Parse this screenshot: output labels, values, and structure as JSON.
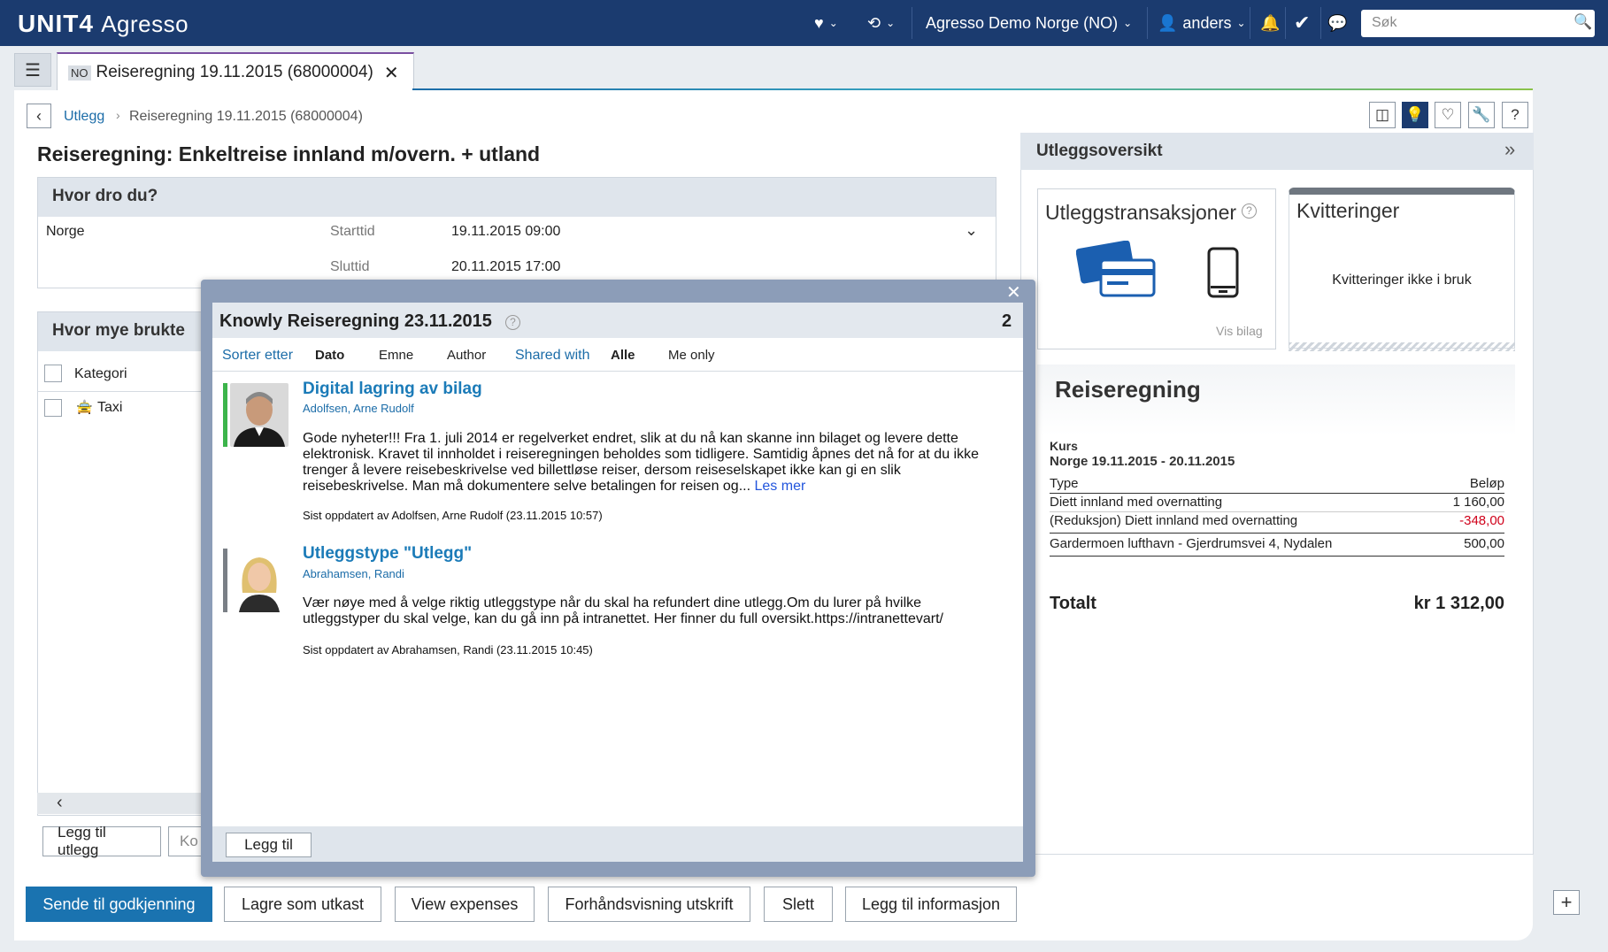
{
  "topbar": {
    "logo_brand": "UNIT4",
    "logo_product": "Agresso",
    "favorites_icon": "heart-icon",
    "history_icon": "history-icon",
    "company": "Agresso Demo Norge (NO)",
    "user": "anders",
    "search_placeholder": "Søk"
  },
  "tabs": [
    {
      "lang": "NO",
      "label": "Reiseregning 19.11.2015 (68000004)"
    }
  ],
  "breadcrumb": {
    "parent": "Utlegg",
    "current": "Reiseregning 19.11.2015 (68000004)"
  },
  "page": {
    "title": "Reiseregning: Enkeltreise innland m/overn. + utland"
  },
  "where": {
    "heading": "Hvor dro du?",
    "destination": "Norge",
    "start_label": "Starttid",
    "start_value": "19.11.2015 09:00",
    "end_label": "Sluttid",
    "end_value": "20.11.2015 17:00"
  },
  "howmuch": {
    "heading": "Hvor mye brukte",
    "col_category": "Kategori",
    "rows": [
      {
        "category": "Taxi"
      }
    ],
    "add_expense": "Legg til utlegg",
    "copy_btn": "Ko"
  },
  "right_panel": {
    "heading": "Utleggsoversikt",
    "transactions_title": "Utleggstransaksjoner",
    "view_attachment": "Vis bilag",
    "receipts_title": "Kvitteringer",
    "receipts_status": "Kvitteringer ikke i bruk",
    "summary": {
      "title": "Reiseregning",
      "kurs_label": "Kurs",
      "kurs_value": "Norge 19.11.2015 - 20.11.2015",
      "col_type": "Type",
      "col_amount": "Beløp",
      "rows": [
        {
          "type": "Diett innland med overnatting",
          "amount": "1 160,00",
          "negative": false
        },
        {
          "type": "(Reduksjon) Diett innland med overnatting",
          "amount": "-348,00",
          "negative": true
        },
        {
          "type": "Gardermoen lufthavn - Gjerdrumsvei 4, Nydalen",
          "amount": "500,00",
          "negative": false
        }
      ],
      "total_label": "Totalt",
      "total_value": "kr 1 312,00"
    }
  },
  "modal": {
    "title": "Knowly Reiseregning 23.11.2015",
    "count": "2",
    "sort_label": "Sorter etter",
    "sort_options": [
      "Dato",
      "Emne",
      "Author"
    ],
    "shared_label": "Shared with",
    "shared_options": [
      "Alle",
      "Me only"
    ],
    "notes": [
      {
        "title": "Digital lagring av bilag",
        "author": "Adolfsen, Arne Rudolf",
        "body": "Gode nyheter!!! Fra 1. juli 2014 er regelverket endret, slik at du nå kan skanne inn bilaget og levere dette elektronisk. Kravet til innholdet i reiseregningen beholdes som tidligere. Samtidig åpnes det nå for at du ikke trenger å levere reisebeskrivelse ved billettløse reiser, dersom reiseselskapet ikke kan gi en slik reisebeskrivelse. Man må dokumentere selve betalingen for reisen og...",
        "read_more": "Les mer",
        "updated": "Sist oppdatert av Adolfsen, Arne Rudolf (23.11.2015 10:57)",
        "bar_color": "#3cb44b"
      },
      {
        "title": "Utleggstype \"Utlegg\"",
        "author": "Abrahamsen, Randi",
        "body": "Vær nøye med å velge riktig utleggstype når du skal ha refundert dine utlegg.Om du lurer på hvilke utleggstyper du skal velge, kan du gå inn på intranettet. Her finner du full oversikt.https://intranettevart/",
        "updated": "Sist oppdatert av Abrahamsen, Randi (23.11.2015 10:45)",
        "bar_color": "#7a7f86"
      }
    ],
    "add_button": "Legg til"
  },
  "actions": {
    "send": "Sende til godkjenning",
    "save_draft": "Lagre som utkast",
    "view_expenses": "View expenses",
    "preview": "Forhåndsvisning utskrift",
    "delete": "Slett",
    "add_info": "Legg til informasjon"
  }
}
